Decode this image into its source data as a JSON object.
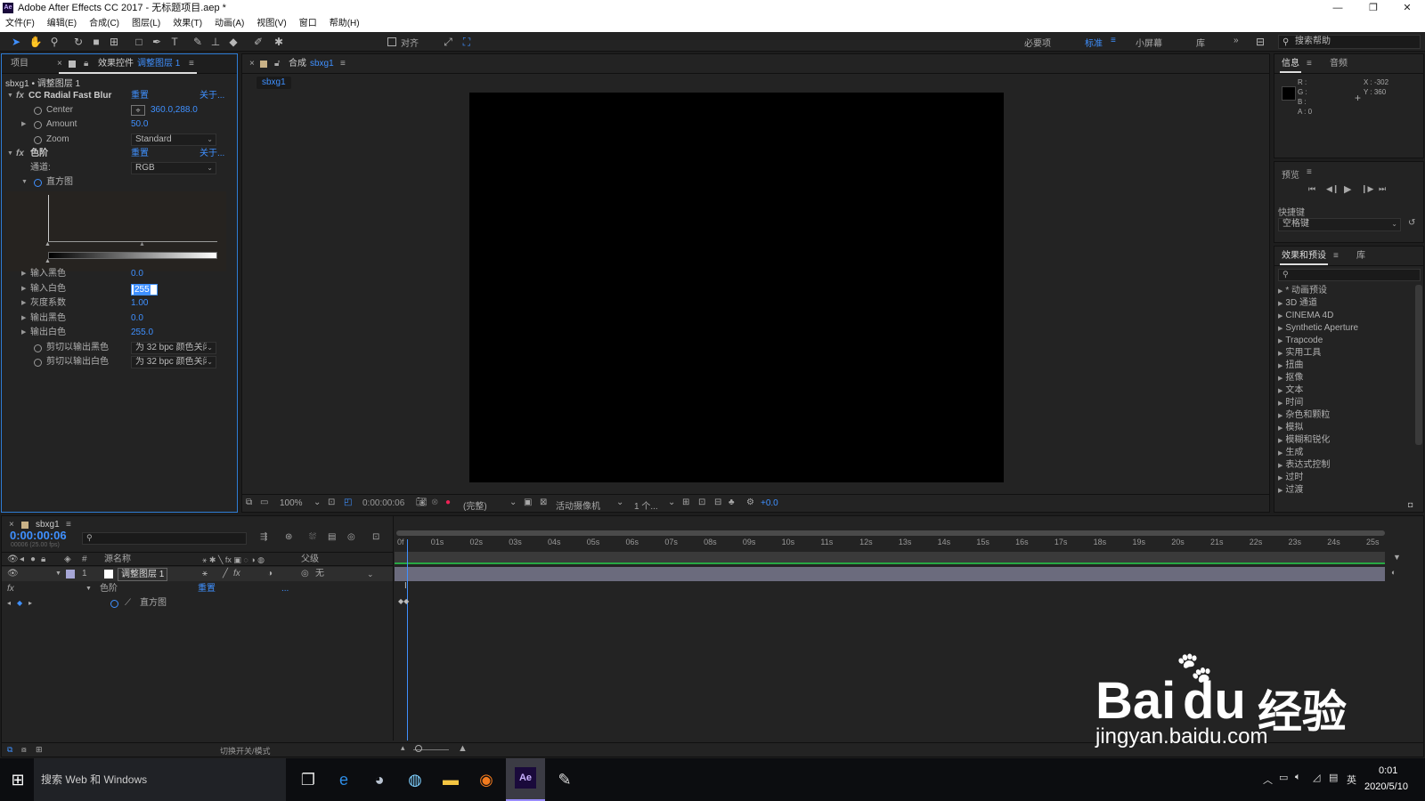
{
  "window": {
    "title": "Adobe After Effects CC 2017 - 无标题项目.aep *",
    "app_badge": "Ae"
  },
  "menu": [
    "文件(F)",
    "编辑(E)",
    "合成(C)",
    "图层(L)",
    "效果(T)",
    "动画(A)",
    "视图(V)",
    "窗口",
    "帮助(H)"
  ],
  "toolbar": {
    "align_label": "对齐",
    "workspaces": [
      "必要项",
      "标准",
      "小屏幕",
      "库"
    ],
    "active_workspace": "标准",
    "search_placeholder": "搜索帮助"
  },
  "left_panel": {
    "tab_project": "项目",
    "tab_effects": "效果控件",
    "tab_effects_layer": "调整图层 1",
    "breadcrumb": "sbxg1 • 调整图层 1",
    "effect1": {
      "name": "CC Radial Fast Blur",
      "reset": "重置",
      "about": "关于...",
      "center_label": "Center",
      "center_value": "360.0,288.0",
      "amount_label": "Amount",
      "amount_value": "50.0",
      "zoom_label": "Zoom",
      "zoom_value": "Standard"
    },
    "effect2": {
      "name": "色阶",
      "reset": "重置",
      "about": "关于...",
      "channel_label": "通道:",
      "channel_value": "RGB",
      "histogram_label": "直方图",
      "props": [
        {
          "label": "输入黑色",
          "value": "0.0"
        },
        {
          "label": "输入白色",
          "value": "255"
        },
        {
          "label": "灰度系数",
          "value": "1.00"
        },
        {
          "label": "输出黑色",
          "value": "0.0"
        },
        {
          "label": "输出白色",
          "value": "255.0"
        }
      ],
      "clip_black_label": "剪切以输出黑色",
      "clip_black_value": "为 32 bpc 颜色关闭",
      "clip_white_label": "剪切以输出白色",
      "clip_white_value": "为 32 bpc 颜色关闭"
    }
  },
  "comp_panel": {
    "tab_prefix": "合成",
    "tab_name": "sbxg1",
    "subtab": "sbxg1",
    "footer": {
      "zoom": "100%",
      "time": "0:00:00:06",
      "resolution": "(完整)",
      "camera": "活动摄像机",
      "views": "1 个...",
      "exposure": "+0.0"
    }
  },
  "info_panel": {
    "tab_info": "信息",
    "tab_audio": "音频",
    "r": "R :",
    "g": "G :",
    "b": "B :",
    "a": "A : 0",
    "x": "X : -302",
    "y": "Y : 360"
  },
  "preview_panel": {
    "title": "预览",
    "shortcut_label": "快捷键",
    "shortcut_value": "空格键"
  },
  "effects_presets": {
    "title": "效果和预设",
    "tab_lib": "库",
    "items": [
      "* 动画预设",
      "3D 通道",
      "CINEMA 4D",
      "Synthetic Aperture",
      "Trapcode",
      "实用工具",
      "扭曲",
      "抠像",
      "文本",
      "时间",
      "杂色和颗粒",
      "模拟",
      "模糊和锐化",
      "生成",
      "表达式控制",
      "过时",
      "过渡"
    ]
  },
  "timeline": {
    "tab": "sbxg1",
    "timecode": "0:00:00:06",
    "fps": "00006 (25.00 fps)",
    "col_source": "源名称",
    "col_parent": "父级",
    "col_num": "#",
    "layer": {
      "num": "1",
      "name": "调整图层 1",
      "parent": "无"
    },
    "effect_row": {
      "name": "色阶",
      "reset": "重置",
      "dots": "..."
    },
    "prop_row": {
      "name": "直方图"
    },
    "footer": "切换开关/模式",
    "ticks": [
      "0f",
      "01s",
      "02s",
      "03s",
      "04s",
      "05s",
      "06s",
      "07s",
      "08s",
      "09s",
      "10s",
      "11s",
      "12s",
      "13s",
      "14s",
      "15s",
      "16s",
      "17s",
      "18s",
      "19s",
      "20s",
      "21s",
      "22s",
      "23s",
      "24s",
      "25s"
    ],
    "playhead_fraction": 0.01
  },
  "taskbar": {
    "search": "搜索 Web 和 Windows",
    "time": "0:01",
    "date": "2020/5/10",
    "ime": "英"
  },
  "watermark": {
    "brand": "Bai",
    "du": "du",
    "cn": "经验",
    "url": "jingyan.baidu.com"
  },
  "colors": {
    "accent": "#3f90ff",
    "green": "#27a844"
  }
}
